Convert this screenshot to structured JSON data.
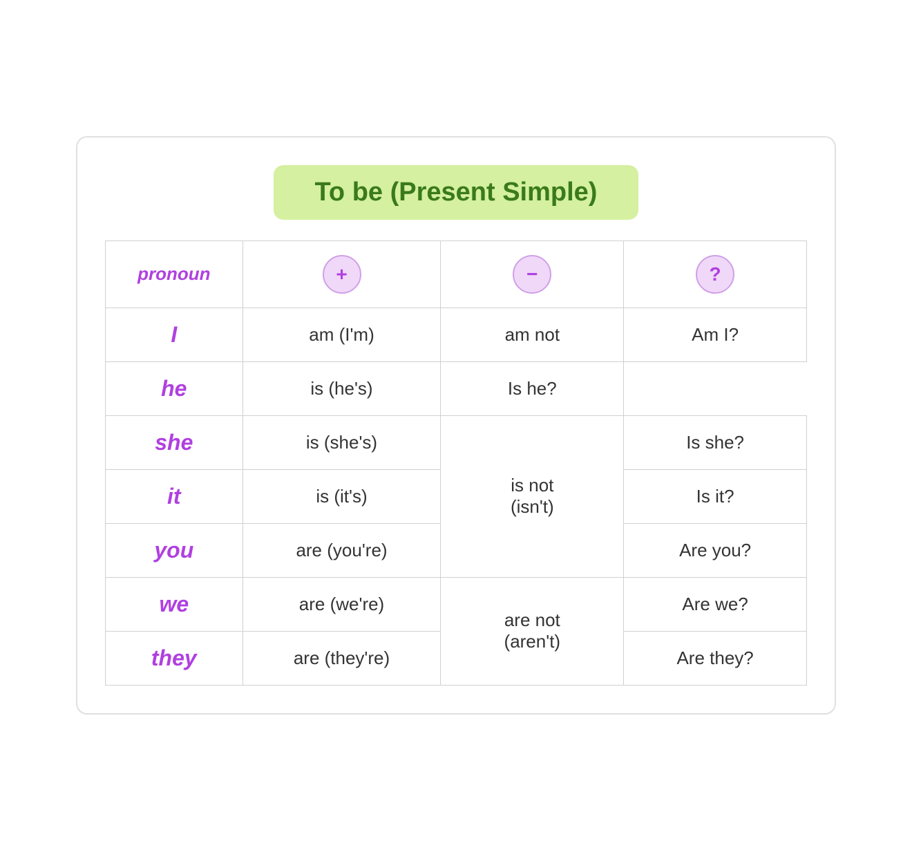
{
  "title": "To be (Present Simple)",
  "header": {
    "pronoun_label": "pronoun",
    "positive_symbol": "+",
    "negative_symbol": "−",
    "question_symbol": "?"
  },
  "rows": [
    {
      "pronoun": "I",
      "positive": "am (I'm)",
      "negative": "am not",
      "negative_rowspan": 1,
      "question": "Am I?"
    },
    {
      "pronoun": "he",
      "positive": "is (he's)",
      "negative": null,
      "question": "Is he?"
    },
    {
      "pronoun": "she",
      "positive": "is (she's)",
      "negative": "is not\n(isn't)",
      "negative_rowspan": 3,
      "question": "Is she?"
    },
    {
      "pronoun": "it",
      "positive": "is (it's)",
      "negative": null,
      "question": "Is it?"
    },
    {
      "pronoun": "you",
      "positive": "are (you're)",
      "negative": null,
      "question": "Are you?"
    },
    {
      "pronoun": "we",
      "positive": "are (we're)",
      "negative": "are not\n(aren't)",
      "negative_rowspan": 3,
      "question": "Are we?"
    },
    {
      "pronoun": "they",
      "positive": "are (they're)",
      "negative": null,
      "question": "Are they?"
    }
  ]
}
